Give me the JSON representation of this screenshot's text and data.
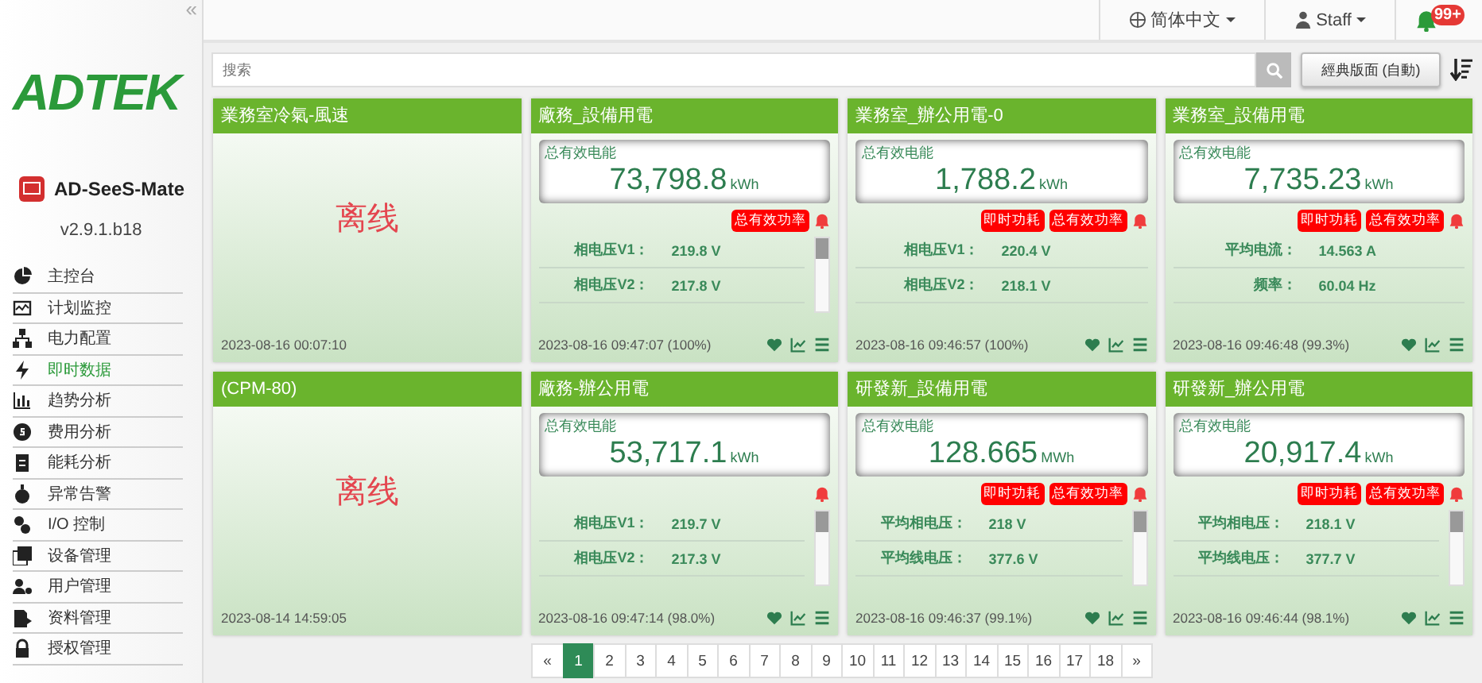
{
  "sidebar": {
    "collapse": "«",
    "logo": "ADTEK",
    "app_name": "AD-SeeS-Mate",
    "version": "v2.9.1.b18",
    "items": [
      {
        "label": "主控台",
        "selected": false
      },
      {
        "label": "计划监控",
        "selected": false
      },
      {
        "label": "电力配置",
        "selected": false
      },
      {
        "label": "即时数据",
        "selected": true
      },
      {
        "label": "趋势分析",
        "selected": false
      },
      {
        "label": "费用分析",
        "selected": false
      },
      {
        "label": "能耗分析",
        "selected": false
      },
      {
        "label": "异常告警",
        "selected": false
      },
      {
        "label": "I/O 控制",
        "selected": false
      },
      {
        "label": "设备管理",
        "selected": false
      },
      {
        "label": "用户管理",
        "selected": false
      },
      {
        "label": "资料管理",
        "selected": false
      },
      {
        "label": "授权管理",
        "selected": false
      }
    ]
  },
  "topbar": {
    "language": "简体中文",
    "user": "Staff",
    "notifications": "99+"
  },
  "search": {
    "placeholder": "搜索"
  },
  "layout_button": "經典版面 (自動)",
  "cards": [
    {
      "kind": "offline",
      "title": "業務室冷氣-風速",
      "status": "离线",
      "time": "2023-08-16 00:07:10"
    },
    {
      "kind": "meter",
      "title": "廠務_設備用電",
      "energy_label": "总有效电能",
      "value": "73,798.8",
      "unit": "kWh",
      "tags": [
        "总有效功率"
      ],
      "scrollable": true,
      "rows": [
        {
          "label": "相电压V1：",
          "value": "219.8 V"
        },
        {
          "label": "相电压V2：",
          "value": "217.8 V"
        }
      ],
      "time": "2023-08-16 09:47:07 (100%)"
    },
    {
      "kind": "meter",
      "title": "業務室_辦公用電-0",
      "energy_label": "总有效电能",
      "value": "1,788.2",
      "unit": "kWh",
      "tags": [
        "即时功耗",
        "总有效功率"
      ],
      "scrollable": false,
      "rows": [
        {
          "label": "相电压V1：",
          "value": "220.4 V"
        },
        {
          "label": "相电压V2：",
          "value": "218.1 V"
        }
      ],
      "time": "2023-08-16 09:46:57 (100%)"
    },
    {
      "kind": "meter",
      "title": "業務室_設備用電",
      "energy_label": "总有效电能",
      "value": "7,735.23",
      "unit": "kWh",
      "tags": [
        "即时功耗",
        "总有效功率"
      ],
      "scrollable": false,
      "rows": [
        {
          "label": "平均电流：",
          "value": "14.563 A"
        },
        {
          "label": "频率：",
          "value": "60.04 Hz"
        }
      ],
      "time": "2023-08-16 09:46:48 (99.3%)"
    },
    {
      "kind": "offline",
      "title": "(CPM-80)",
      "status": "离线",
      "time": "2023-08-14 14:59:05"
    },
    {
      "kind": "meter",
      "title": "廠務-辦公用電",
      "energy_label": "总有效电能",
      "value": "53,717.1",
      "unit": "kWh",
      "scrollable": true,
      "rows": [
        {
          "label": "相电压V1：",
          "value": "219.7 V"
        },
        {
          "label": "相电压V2：",
          "value": "217.3 V"
        }
      ],
      "time": "2023-08-16 09:47:14 (98.0%)"
    },
    {
      "kind": "meter",
      "title": "研發新_設備用電",
      "energy_label": "总有效电能",
      "value": "128.665",
      "unit": "MWh",
      "tags": [
        "即时功耗",
        "总有效功率"
      ],
      "scrollable": true,
      "rows": [
        {
          "label": "平均相电压：",
          "value": "218 V"
        },
        {
          "label": "平均线电压：",
          "value": "377.6 V"
        }
      ],
      "time": "2023-08-16 09:46:37 (99.1%)"
    },
    {
      "kind": "meter",
      "title": "研發新_辦公用電",
      "energy_label": "总有效电能",
      "value": "20,917.4",
      "unit": "kWh",
      "tags": [
        "即时功耗",
        "总有效功率"
      ],
      "scrollable": true,
      "rows": [
        {
          "label": "平均相电压：",
          "value": "218.1 V"
        },
        {
          "label": "平均线电压：",
          "value": "377.7 V"
        }
      ],
      "time": "2023-08-16 09:46:44 (98.1%)"
    }
  ],
  "pagination": {
    "prev": "«",
    "next": "»",
    "pages": [
      {
        "label": "1",
        "selected": true
      },
      {
        "label": "2",
        "selected": false
      },
      {
        "label": "3",
        "selected": false
      },
      {
        "label": "4",
        "selected": false
      },
      {
        "label": "5",
        "selected": false
      },
      {
        "label": "6",
        "selected": false
      },
      {
        "label": "7",
        "selected": false
      },
      {
        "label": "8",
        "selected": false
      },
      {
        "label": "9",
        "selected": false
      },
      {
        "label": "10",
        "selected": false
      },
      {
        "label": "11",
        "selected": false
      },
      {
        "label": "12",
        "selected": false
      },
      {
        "label": "13",
        "selected": false
      },
      {
        "label": "14",
        "selected": false
      },
      {
        "label": "15",
        "selected": false
      },
      {
        "label": "16",
        "selected": false
      },
      {
        "label": "17",
        "selected": false
      },
      {
        "label": "18",
        "selected": false
      }
    ]
  }
}
